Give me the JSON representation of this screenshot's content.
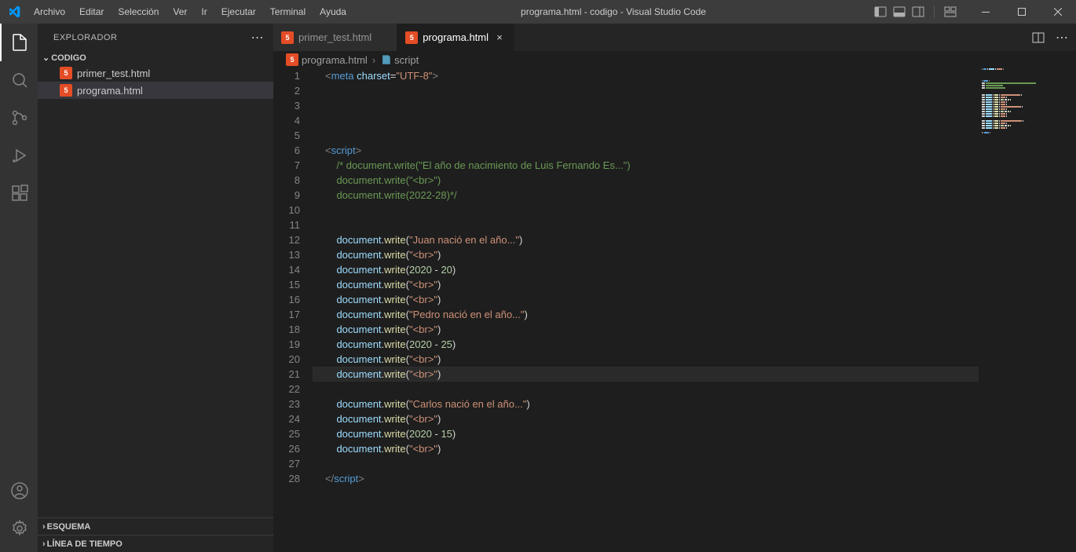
{
  "titlebar": {
    "menus": [
      "Archivo",
      "Editar",
      "Selección",
      "Ver",
      "Ir",
      "Ejecutar",
      "Terminal",
      "Ayuda"
    ],
    "title": "programa.html - codigo - Visual Studio Code"
  },
  "sidebar": {
    "header": "EXPLORADOR",
    "folder": "CODIGO",
    "files": [
      {
        "name": "primer_test.html",
        "active": false
      },
      {
        "name": "programa.html",
        "active": true
      }
    ],
    "sections": [
      "ESQUEMA",
      "LÍNEA DE TIEMPO"
    ]
  },
  "tabs": [
    {
      "name": "primer_test.html",
      "active": false
    },
    {
      "name": "programa.html",
      "active": true
    }
  ],
  "breadcrumb": {
    "file": "programa.html",
    "symbol": "script"
  },
  "code": {
    "lines": [
      {
        "n": 1,
        "tokens": [
          [
            "gray",
            "<"
          ],
          [
            "blue",
            "meta"
          ],
          [
            "white",
            " "
          ],
          [
            "lightblue",
            "charset"
          ],
          [
            "white",
            "="
          ],
          [
            "orange",
            "\"UTF-8\""
          ],
          [
            "gray",
            ">"
          ]
        ]
      },
      {
        "n": 2,
        "tokens": []
      },
      {
        "n": 3,
        "tokens": []
      },
      {
        "n": 4,
        "tokens": []
      },
      {
        "n": 5,
        "tokens": []
      },
      {
        "n": 6,
        "tokens": [
          [
            "gray",
            "<"
          ],
          [
            "blue",
            "script"
          ],
          [
            "gray",
            ">"
          ]
        ]
      },
      {
        "n": 7,
        "tokens": [
          [
            "white",
            "    "
          ],
          [
            "green",
            "/* document.write(\"El año de nacimiento de Luis Fernando Es...\")"
          ]
        ]
      },
      {
        "n": 8,
        "tokens": [
          [
            "white",
            "    "
          ],
          [
            "green",
            "document.write(\"<br>\")"
          ]
        ]
      },
      {
        "n": 9,
        "tokens": [
          [
            "white",
            "    "
          ],
          [
            "green",
            "document.write(2022-28)*/"
          ]
        ]
      },
      {
        "n": 10,
        "tokens": []
      },
      {
        "n": 11,
        "tokens": []
      },
      {
        "n": 12,
        "tokens": [
          [
            "white",
            "    "
          ],
          [
            "lightblue",
            "document"
          ],
          [
            "white",
            "."
          ],
          [
            "yellow",
            "write"
          ],
          [
            "white",
            "("
          ],
          [
            "orange",
            "\"Juan nació en el año...\""
          ],
          [
            "white",
            ")"
          ]
        ]
      },
      {
        "n": 13,
        "tokens": [
          [
            "white",
            "    "
          ],
          [
            "lightblue",
            "document"
          ],
          [
            "white",
            "."
          ],
          [
            "yellow",
            "write"
          ],
          [
            "white",
            "("
          ],
          [
            "orange",
            "\"<br>\""
          ],
          [
            "white",
            ")"
          ]
        ]
      },
      {
        "n": 14,
        "tokens": [
          [
            "white",
            "    "
          ],
          [
            "lightblue",
            "document"
          ],
          [
            "white",
            "."
          ],
          [
            "yellow",
            "write"
          ],
          [
            "white",
            "("
          ],
          [
            "num",
            "2020"
          ],
          [
            "white",
            " - "
          ],
          [
            "num",
            "20"
          ],
          [
            "white",
            ")"
          ]
        ]
      },
      {
        "n": 15,
        "tokens": [
          [
            "white",
            "    "
          ],
          [
            "lightblue",
            "document"
          ],
          [
            "white",
            "."
          ],
          [
            "yellow",
            "write"
          ],
          [
            "white",
            "("
          ],
          [
            "orange",
            "\"<br>\""
          ],
          [
            "white",
            ")"
          ]
        ]
      },
      {
        "n": 16,
        "tokens": [
          [
            "white",
            "    "
          ],
          [
            "lightblue",
            "document"
          ],
          [
            "white",
            "."
          ],
          [
            "yellow",
            "write"
          ],
          [
            "white",
            "("
          ],
          [
            "orange",
            "\"<br>\""
          ],
          [
            "white",
            ")"
          ]
        ]
      },
      {
        "n": 17,
        "tokens": [
          [
            "white",
            "    "
          ],
          [
            "lightblue",
            "document"
          ],
          [
            "white",
            "."
          ],
          [
            "yellow",
            "write"
          ],
          [
            "white",
            "("
          ],
          [
            "orange",
            "\"Pedro nació en el año...\""
          ],
          [
            "white",
            ")"
          ]
        ]
      },
      {
        "n": 18,
        "tokens": [
          [
            "white",
            "    "
          ],
          [
            "lightblue",
            "document"
          ],
          [
            "white",
            "."
          ],
          [
            "yellow",
            "write"
          ],
          [
            "white",
            "("
          ],
          [
            "orange",
            "\"<br>\""
          ],
          [
            "white",
            ")"
          ]
        ]
      },
      {
        "n": 19,
        "tokens": [
          [
            "white",
            "    "
          ],
          [
            "lightblue",
            "document"
          ],
          [
            "white",
            "."
          ],
          [
            "yellow",
            "write"
          ],
          [
            "white",
            "("
          ],
          [
            "num",
            "2020"
          ],
          [
            "white",
            " - "
          ],
          [
            "num",
            "25"
          ],
          [
            "white",
            ")"
          ]
        ]
      },
      {
        "n": 20,
        "tokens": [
          [
            "white",
            "    "
          ],
          [
            "lightblue",
            "document"
          ],
          [
            "white",
            "."
          ],
          [
            "yellow",
            "write"
          ],
          [
            "white",
            "("
          ],
          [
            "orange",
            "\"<br>\""
          ],
          [
            "white",
            ")"
          ]
        ]
      },
      {
        "n": 21,
        "tokens": [
          [
            "white",
            "    "
          ],
          [
            "lightblue",
            "document"
          ],
          [
            "white",
            "."
          ],
          [
            "yellow",
            "write"
          ],
          [
            "white",
            "("
          ],
          [
            "orange",
            "\"<br>\""
          ],
          [
            "white",
            ")"
          ]
        ],
        "highlight": true
      },
      {
        "n": 22,
        "tokens": []
      },
      {
        "n": 23,
        "tokens": [
          [
            "white",
            "    "
          ],
          [
            "lightblue",
            "document"
          ],
          [
            "white",
            "."
          ],
          [
            "yellow",
            "write"
          ],
          [
            "white",
            "("
          ],
          [
            "orange",
            "\"Carlos nació en el año...\""
          ],
          [
            "white",
            ")"
          ]
        ]
      },
      {
        "n": 24,
        "tokens": [
          [
            "white",
            "    "
          ],
          [
            "lightblue",
            "document"
          ],
          [
            "white",
            "."
          ],
          [
            "yellow",
            "write"
          ],
          [
            "white",
            "("
          ],
          [
            "orange",
            "\"<br>\""
          ],
          [
            "white",
            ")"
          ]
        ]
      },
      {
        "n": 25,
        "tokens": [
          [
            "white",
            "    "
          ],
          [
            "lightblue",
            "document"
          ],
          [
            "white",
            "."
          ],
          [
            "yellow",
            "write"
          ],
          [
            "white",
            "("
          ],
          [
            "num",
            "2020"
          ],
          [
            "white",
            " - "
          ],
          [
            "num",
            "15"
          ],
          [
            "white",
            ")"
          ]
        ]
      },
      {
        "n": 26,
        "tokens": [
          [
            "white",
            "    "
          ],
          [
            "lightblue",
            "document"
          ],
          [
            "white",
            "."
          ],
          [
            "yellow",
            "write"
          ],
          [
            "white",
            "("
          ],
          [
            "orange",
            "\"<br>\""
          ],
          [
            "white",
            ")"
          ]
        ]
      },
      {
        "n": 27,
        "tokens": []
      },
      {
        "n": 28,
        "tokens": [
          [
            "gray",
            "</"
          ],
          [
            "blue",
            "script"
          ],
          [
            "gray",
            ">"
          ]
        ]
      }
    ]
  }
}
